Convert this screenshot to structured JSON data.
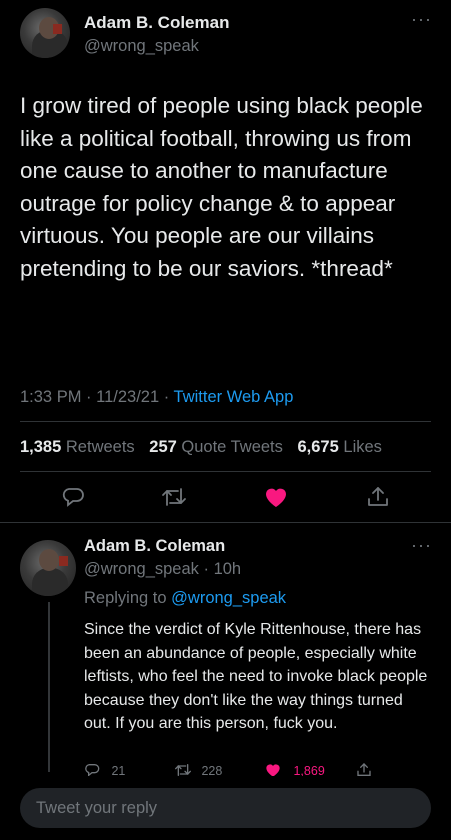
{
  "tweet": {
    "author_name": "Adam B. Coleman",
    "author_handle": "@wrong_speak",
    "more_icon": "more-horizontal-icon",
    "text": "I grow tired of people using black people like a political football, throwing us from one cause to another to manufacture outrage for policy change & to appear virtuous. You people are our villains pretending to be our saviors. *thread*",
    "time": "1:33 PM",
    "date": "11/23/21",
    "separator": "·",
    "source_app": "Twitter Web App",
    "stats": {
      "retweets_count": "1,385",
      "retweets_label": "Retweets",
      "quote_count": "257",
      "quote_label": "Quote Tweets",
      "likes_count": "6,675",
      "likes_label": "Likes"
    },
    "actions": [
      "reply-icon",
      "retweet-icon",
      "like-icon",
      "share-icon"
    ],
    "like_color": "#f91880"
  },
  "reply": {
    "author_name": "Adam B. Coleman",
    "author_handle": "@wrong_speak",
    "time_ago": "· 10h",
    "replying_prefix": "Replying to",
    "replying_to": "@wrong_speak",
    "text": "Since the verdict of Kyle Rittenhouse, there has been an abundance of people, especially white leftists, who feel the need to invoke black people because they don't like the way things turned out. If you are this person, fuck you.",
    "reply_count": "21",
    "retweet_count": "228",
    "like_count": "1,869"
  },
  "composer": {
    "placeholder": "Tweet your reply"
  },
  "colors": {
    "background": "#000000",
    "text": "#e7e9ea",
    "muted": "#71767b",
    "accent": "#1d9bf0",
    "like": "#f91880"
  }
}
